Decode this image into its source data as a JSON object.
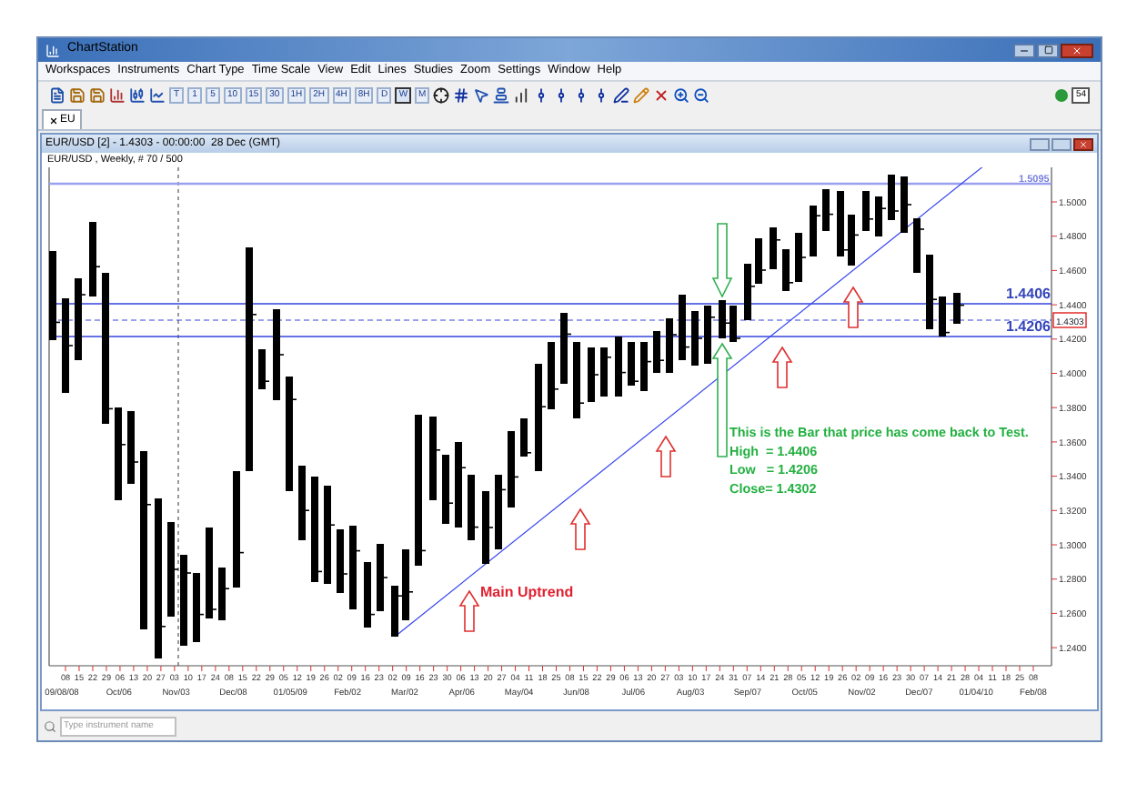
{
  "window": {
    "title": "ChartStation",
    "status_badge": "54"
  },
  "menu": [
    "Workspaces",
    "Instruments",
    "Chart Type",
    "Time Scale",
    "View",
    "Edit",
    "Lines",
    "Studies",
    "Zoom",
    "Settings",
    "Window",
    "Help"
  ],
  "toolbar": [
    {
      "kind": "new"
    },
    {
      "kind": "save"
    },
    {
      "kind": "save"
    },
    {
      "kind": "bars"
    },
    {
      "kind": "candles"
    },
    {
      "kind": "line"
    },
    {
      "kind": "text",
      "label": "T",
      "selected": false
    },
    {
      "kind": "text",
      "label": "1",
      "selected": false
    },
    {
      "kind": "text",
      "label": "5",
      "selected": false
    },
    {
      "kind": "text",
      "label": "10",
      "selected": false
    },
    {
      "kind": "text",
      "label": "15",
      "selected": false
    },
    {
      "kind": "text",
      "label": "30",
      "selected": false
    },
    {
      "kind": "text",
      "label": "1H",
      "selected": false
    },
    {
      "kind": "text",
      "label": "2H",
      "selected": false
    },
    {
      "kind": "text",
      "label": "4H",
      "selected": false
    },
    {
      "kind": "text",
      "label": "8H",
      "selected": false
    },
    {
      "kind": "text",
      "label": "D",
      "selected": false
    },
    {
      "kind": "text",
      "label": "W",
      "selected": true
    },
    {
      "kind": "text",
      "label": "M",
      "selected": false
    },
    {
      "kind": "crosshair"
    },
    {
      "kind": "grid"
    },
    {
      "kind": "cursor"
    },
    {
      "kind": "levels"
    },
    {
      "kind": "volume"
    },
    {
      "kind": "tool"
    },
    {
      "kind": "tool"
    },
    {
      "kind": "tool"
    },
    {
      "kind": "tool"
    },
    {
      "kind": "pen"
    },
    {
      "kind": "pencil"
    },
    {
      "kind": "erase"
    },
    {
      "kind": "zoom-in"
    },
    {
      "kind": "zoom-out"
    }
  ],
  "tabs": [
    {
      "label": "EU",
      "selected": true
    }
  ],
  "chart_window": {
    "title": "EUR/USD [2] - 1.4303 - 00:00:00  28 Dec (GMT)",
    "info": "EUR/USD , Weekly, # 70 / 500",
    "level_lines": [
      {
        "label": "1.5095"
      },
      {
        "label": "1.4406"
      },
      {
        "label": "1.4206"
      }
    ],
    "price_marker": "1.4303",
    "uptrend_label": "Main Uptrend",
    "callout": [
      "This is the Bar that price has come back to Test.",
      "High  = 1.4406",
      "Low   = 1.4206",
      "Close= 1.4302"
    ],
    "y_ticks": [
      "1.5000",
      "1.4800",
      "1.4600",
      "1.4400",
      "1.4200",
      "1.4000",
      "1.3800",
      "1.3600",
      "1.3400",
      "1.3200",
      "1.3000",
      "1.2800",
      "1.2600",
      "1.2400"
    ],
    "day_labels": [
      "08",
      "15",
      "22",
      "29",
      "06",
      "13",
      "20",
      "27",
      "03",
      "10",
      "17",
      "24",
      "08",
      "15",
      "22",
      "29",
      "05",
      "12",
      "19",
      "26",
      "02",
      "09",
      "16",
      "23",
      "02",
      "09",
      "16",
      "23",
      "30",
      "06",
      "13",
      "20",
      "27",
      "04",
      "11",
      "18",
      "25",
      "08",
      "15",
      "22",
      "29",
      "06",
      "13",
      "20",
      "27",
      "03",
      "10",
      "17",
      "24",
      "31",
      "07",
      "14",
      "21",
      "28",
      "05",
      "12",
      "19",
      "26",
      "02",
      "09",
      "16",
      "23",
      "30",
      "07",
      "14",
      "21",
      "28",
      "04",
      "11",
      "18",
      "25",
      "08"
    ],
    "month_labels": [
      "09/08/08",
      "Oct/06",
      "Nov/03",
      "Dec/08",
      "01/05/09",
      "Feb/02",
      "Mar/02",
      "Apr/06",
      "May/04",
      "Jun/08",
      "Jul/06",
      "Aug/03",
      "Sep/07",
      "Oct/05",
      "Nov/02",
      "Dec/07",
      "01/04/10",
      "Feb/08"
    ]
  },
  "search": {
    "placeholder": "Type instrument name"
  }
}
